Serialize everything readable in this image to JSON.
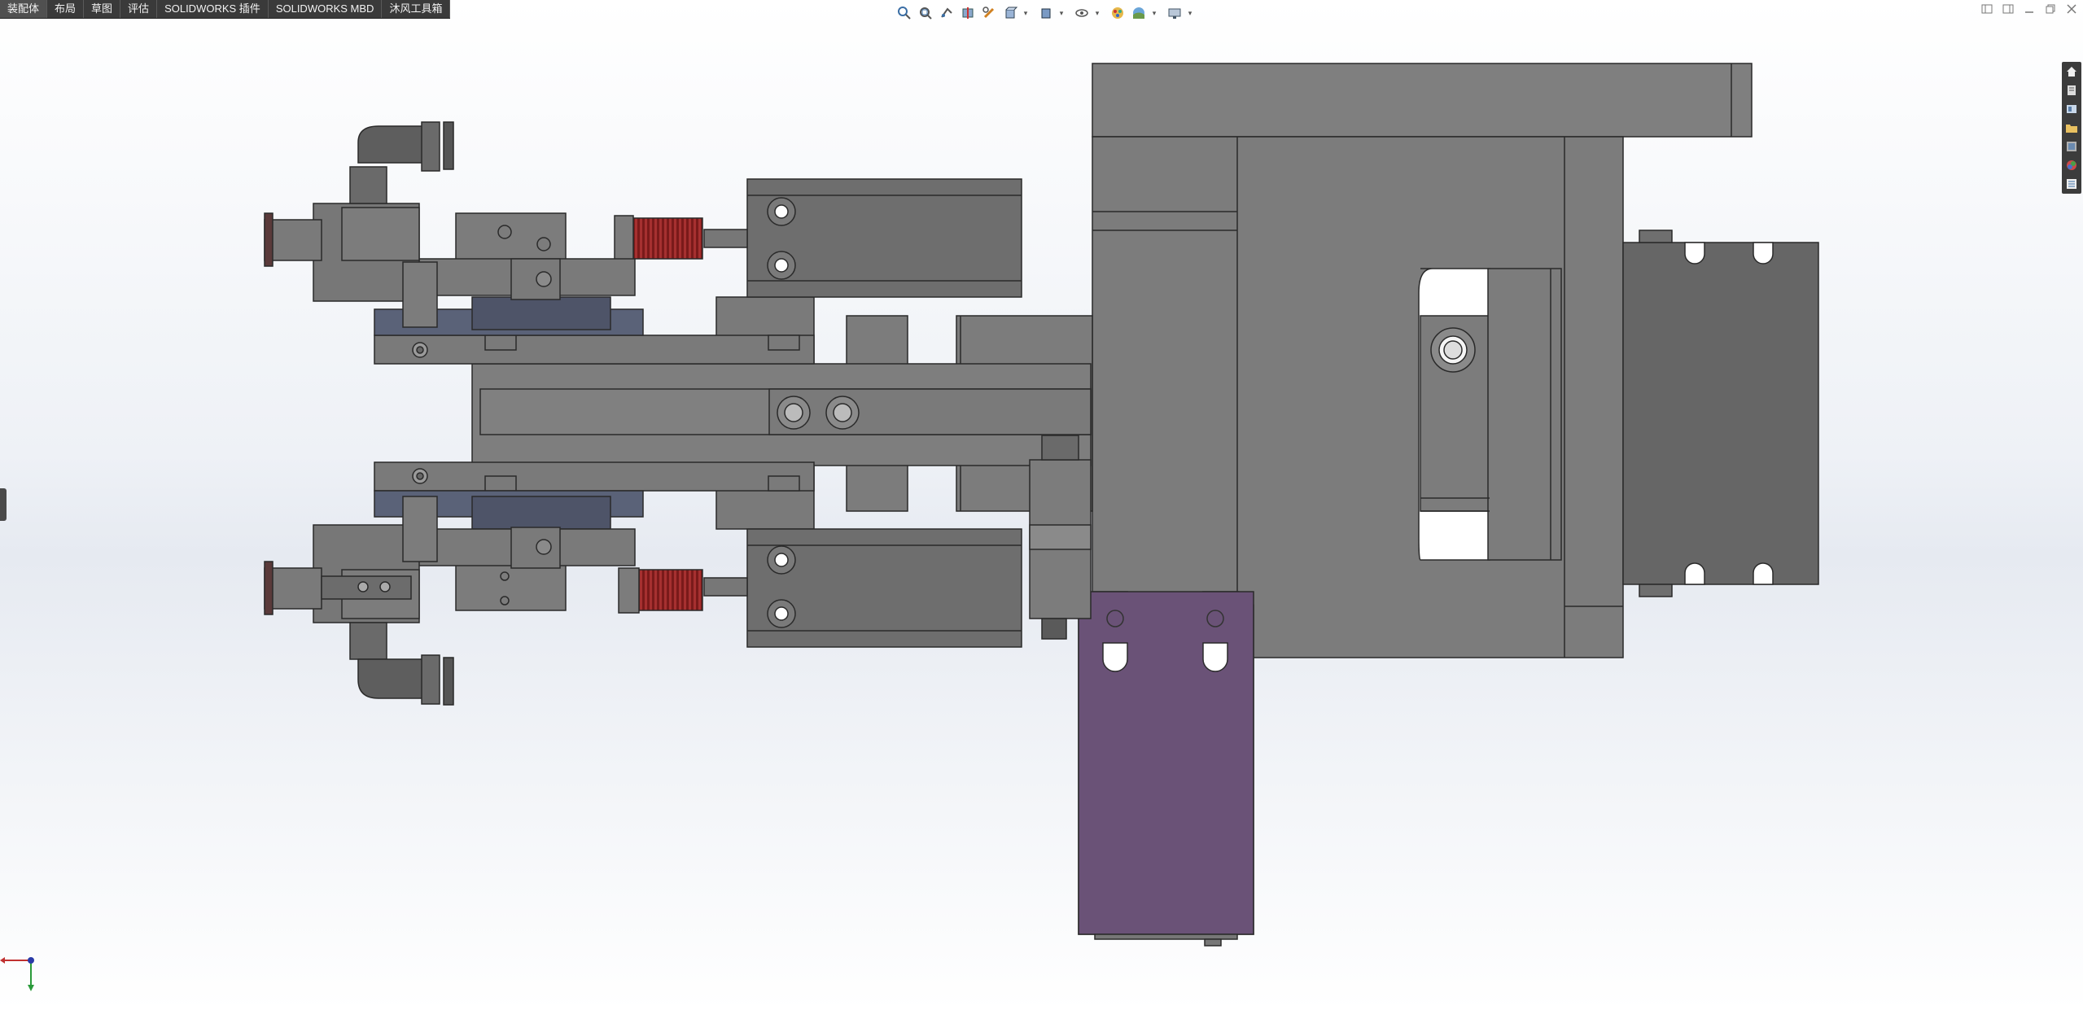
{
  "command_tabs": [
    {
      "label": "装配体"
    },
    {
      "label": "布局"
    },
    {
      "label": "草图"
    },
    {
      "label": "评估"
    },
    {
      "label": "SOLIDWORKS 插件"
    },
    {
      "label": "SOLIDWORKS MBD"
    },
    {
      "label": "沐风工具箱"
    }
  ],
  "view_toolbar": [
    {
      "icon": "zoom-to-fit-icon"
    },
    {
      "icon": "zoom-to-area-icon"
    },
    {
      "icon": "previous-view-icon"
    },
    {
      "icon": "section-view-icon"
    },
    {
      "icon": "dynamic-annotation-icon"
    },
    {
      "icon": "view-orientation-icon"
    },
    {
      "icon": "display-style-icon"
    },
    {
      "icon": "hide-show-items-icon"
    },
    {
      "icon": "edit-appearance-icon"
    },
    {
      "icon": "apply-scene-icon"
    },
    {
      "icon": "view-settings-icon"
    }
  ],
  "task_pane": [
    {
      "icon": "home-icon"
    },
    {
      "icon": "resources-icon"
    },
    {
      "icon": "design-library-icon"
    },
    {
      "icon": "file-explorer-icon"
    },
    {
      "icon": "view-palette-icon"
    },
    {
      "icon": "appearances-icon"
    },
    {
      "icon": "custom-properties-icon"
    }
  ],
  "colors": {
    "part_gray": "#808080",
    "dark_part": "#6a6a6a",
    "purple_part": "#6a5277",
    "spring_red": "#8b2020",
    "rail_blue": "#5a6278"
  }
}
